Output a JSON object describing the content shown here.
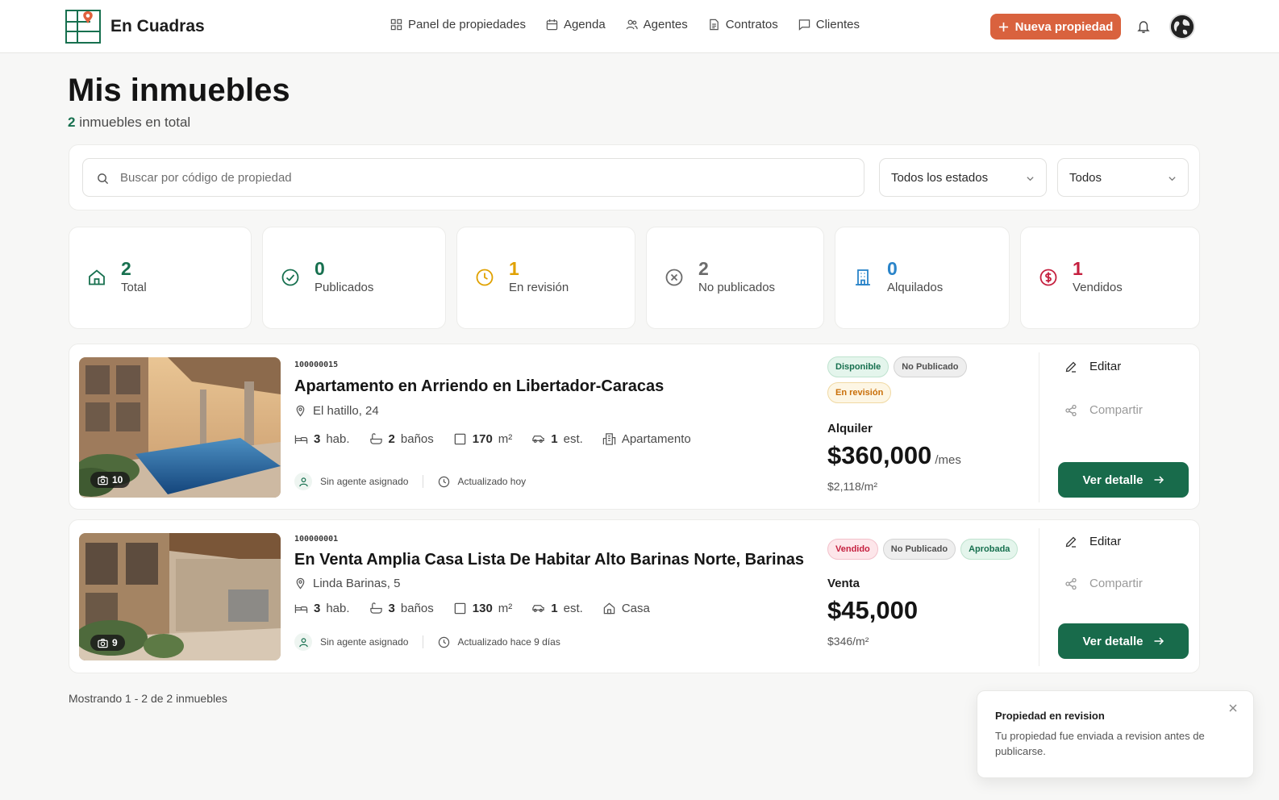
{
  "app": {
    "brand": "En Cuadras"
  },
  "nav": [
    {
      "label": "Panel de propiedades",
      "icon": "grid-icon"
    },
    {
      "label": "Agenda",
      "icon": "calendar-icon"
    },
    {
      "label": "Agentes",
      "icon": "users-icon"
    },
    {
      "label": "Contratos",
      "icon": "document-icon"
    },
    {
      "label": "Clientes",
      "icon": "chat-icon"
    }
  ],
  "header": {
    "new_label": "Nueva propiedad"
  },
  "page": {
    "title": "Mis inmuebles",
    "count": "2",
    "count_suffix": "inmuebles en total"
  },
  "filters": {
    "search_placeholder": "Buscar por código de propiedad",
    "status_select": "Todos los estados",
    "type_select": "Todos"
  },
  "stats": [
    {
      "value": "2",
      "label": "Total",
      "icon": "home-icon",
      "color": "#17704f"
    },
    {
      "value": "0",
      "label": "Publicados",
      "icon": "check-circle-icon",
      "color": "#17704f"
    },
    {
      "value": "1",
      "label": "En revisión",
      "icon": "clock-icon",
      "color": "#e0a100"
    },
    {
      "value": "2",
      "label": "No publicados",
      "icon": "x-circle-icon",
      "color": "#6b6b6b"
    },
    {
      "value": "0",
      "label": "Alquilados",
      "icon": "building-icon",
      "color": "#2a84c9"
    },
    {
      "value": "1",
      "label": "Vendidos",
      "icon": "dollar-circle-icon",
      "color": "#c5203f"
    }
  ],
  "properties": [
    {
      "code": "100000015",
      "title": "Apartamento en Arriendo en Libertador-Caracas",
      "address": "El hatillo, 24",
      "photos": "10",
      "rooms": "3",
      "rooms_unit": "hab.",
      "baths": "2",
      "baths_unit": "baños",
      "area": "170",
      "area_unit": "m²",
      "parking": "1",
      "parking_unit": "est.",
      "kind": "Apartamento",
      "agent": "Sin agente asignado",
      "updated": "Actualizado hoy",
      "badges": [
        {
          "label": "Disponible",
          "tone": "green"
        },
        {
          "label": "No Publicado",
          "tone": "gray"
        },
        {
          "label": "En revisión",
          "tone": "orange"
        }
      ],
      "op_type": "Alquiler",
      "price": "$360,000",
      "price_suffix": "/mes",
      "price_per_m2": "$2,118/m²"
    },
    {
      "code": "100000001",
      "title": "En Venta Amplia Casa Lista De Habitar Alto Barinas Norte, Barinas",
      "address": "Linda Barinas, 5",
      "photos": "9",
      "rooms": "3",
      "rooms_unit": "hab.",
      "baths": "3",
      "baths_unit": "baños",
      "area": "130",
      "area_unit": "m²",
      "parking": "1",
      "parking_unit": "est.",
      "kind": "Casa",
      "agent": "Sin agente asignado",
      "updated": "Actualizado hace 9 días",
      "badges": [
        {
          "label": "Vendido",
          "tone": "red"
        },
        {
          "label": "No Publicado",
          "tone": "gray"
        },
        {
          "label": "Aprobada",
          "tone": "green"
        }
      ],
      "op_type": "Venta",
      "price": "$45,000",
      "price_suffix": "",
      "price_per_m2": "$346/m²"
    }
  ],
  "actions": {
    "edit": "Editar",
    "share": "Compartir",
    "detail": "Ver detalle"
  },
  "footer": {
    "showing": "Mostrando 1 - 2 de 2 inmuebles"
  },
  "toast": {
    "title": "Propiedad en revision",
    "body": "Tu propiedad fue enviada a revision antes de publicarse."
  },
  "colors": {
    "accent": "#d9623e",
    "primary": "#186b4b"
  }
}
